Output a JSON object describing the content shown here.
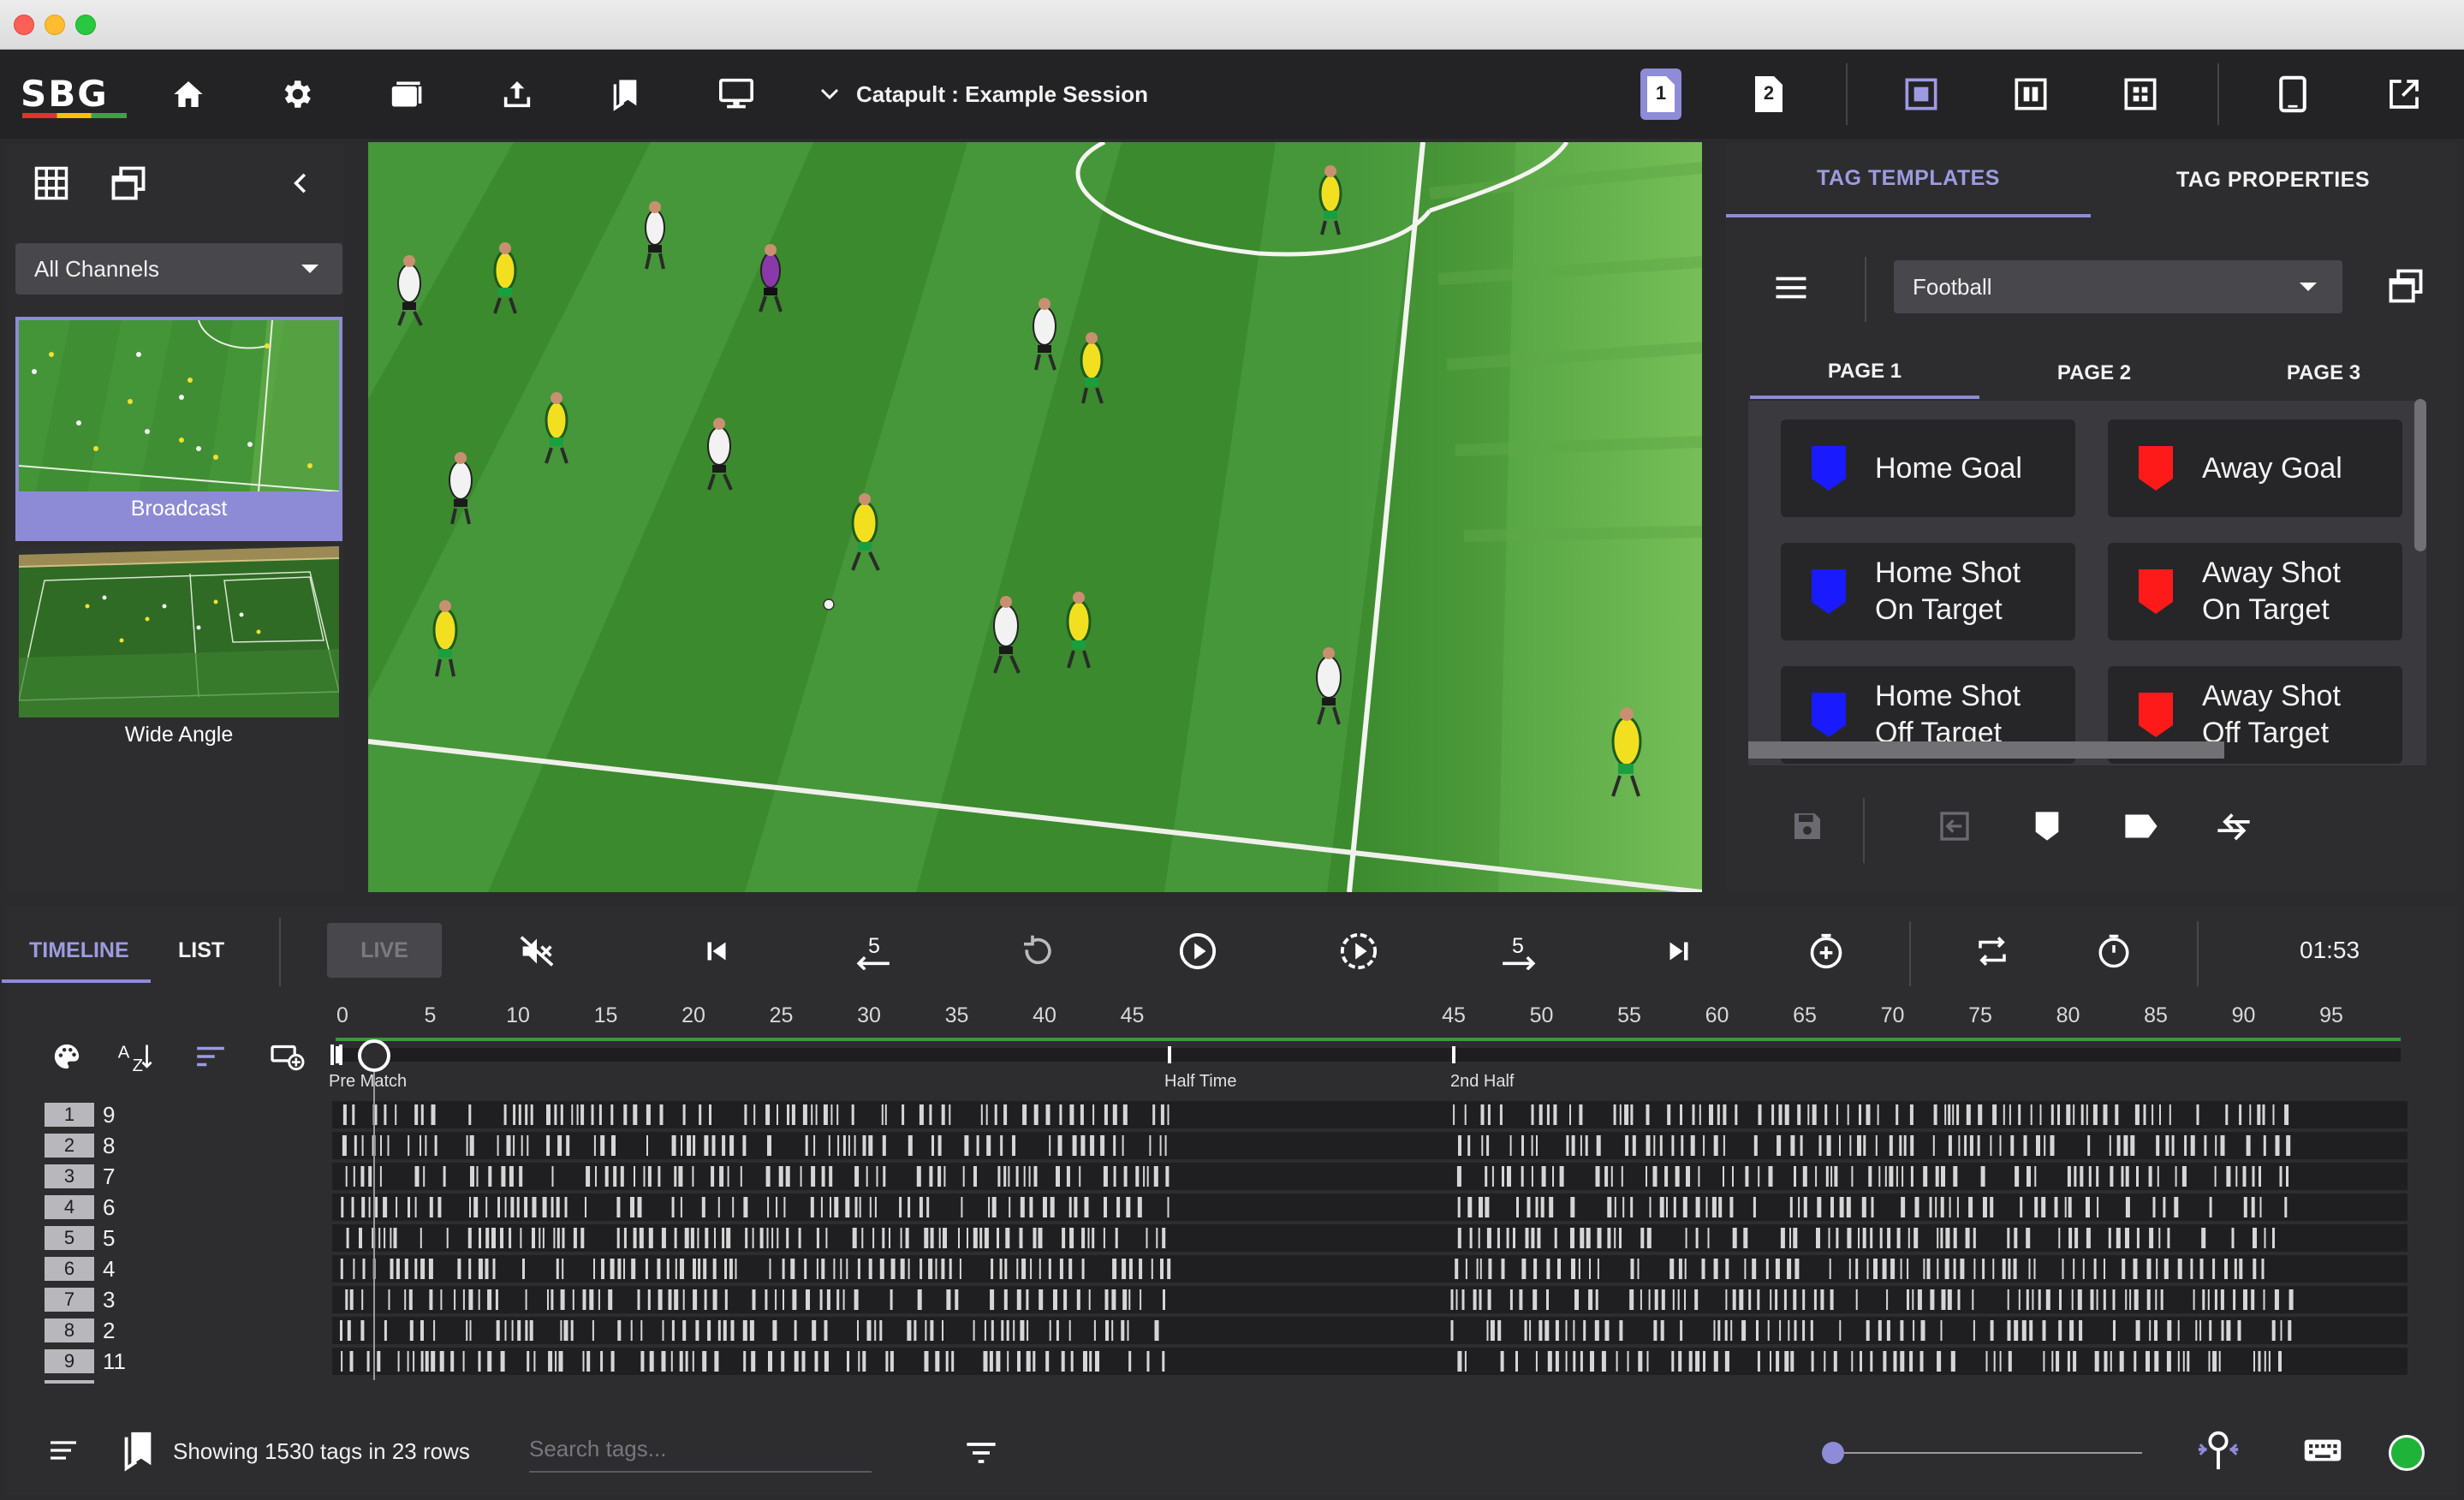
{
  "session": {
    "title": "Catapult : Example Session"
  },
  "logo": {
    "text": "SBG"
  },
  "sidebar": {
    "channel_select": "All Channels",
    "channels": [
      {
        "label": "Broadcast",
        "selected": true
      },
      {
        "label": "Wide Angle",
        "selected": false
      }
    ]
  },
  "toolbar": {
    "page_buttons": [
      "1",
      "2"
    ]
  },
  "right_panel": {
    "tabs": [
      "TAG TEMPLATES",
      "TAG PROPERTIES"
    ],
    "active_tab": "TAG TEMPLATES",
    "template_select": "Football",
    "page_tabs": [
      "PAGE 1",
      "PAGE 2",
      "PAGE 3"
    ],
    "active_page": "PAGE 1",
    "tags": [
      {
        "line1": "Home Goal",
        "line2": "",
        "color": "#1a1aff"
      },
      {
        "line1": "Away Goal",
        "line2": "",
        "color": "#ff1a1a"
      },
      {
        "line1": "Home Shot",
        "line2": "On Target",
        "color": "#1a1aff"
      },
      {
        "line1": "Away Shot",
        "line2": "On Target",
        "color": "#ff1a1a"
      },
      {
        "line1": "Home Shot",
        "line2": "Off Target",
        "color": "#1a1aff"
      },
      {
        "line1": "Away Shot",
        "line2": "Off Target",
        "color": "#ff1a1a"
      }
    ]
  },
  "bottom": {
    "tabs": [
      "TIMELINE",
      "LIST"
    ],
    "active_tab": "TIMELINE",
    "live_label": "LIVE",
    "skip_back_label": "5",
    "skip_fwd_label": "5",
    "clock": "01:53",
    "ticks_first_half": [
      "0",
      "5",
      "10",
      "15",
      "20",
      "25",
      "30",
      "35",
      "40",
      "45"
    ],
    "ticks_second_half": [
      "45",
      "50",
      "55",
      "60",
      "65",
      "70",
      "75",
      "80",
      "85",
      "90",
      "95"
    ],
    "markers": [
      "Pre Match",
      "Half Time",
      "2nd Half"
    ],
    "rows": [
      {
        "num": "1",
        "value": "9"
      },
      {
        "num": "2",
        "value": "8"
      },
      {
        "num": "3",
        "value": "7"
      },
      {
        "num": "4",
        "value": "6"
      },
      {
        "num": "5",
        "value": "5"
      },
      {
        "num": "6",
        "value": "4"
      },
      {
        "num": "7",
        "value": "3"
      },
      {
        "num": "8",
        "value": "2"
      },
      {
        "num": "9",
        "value": "11"
      }
    ],
    "status": "Showing 1530 tags in 23 rows",
    "search_placeholder": "Search tags...",
    "status_color": "#1fb33a",
    "accent": "#8e8bd8"
  }
}
